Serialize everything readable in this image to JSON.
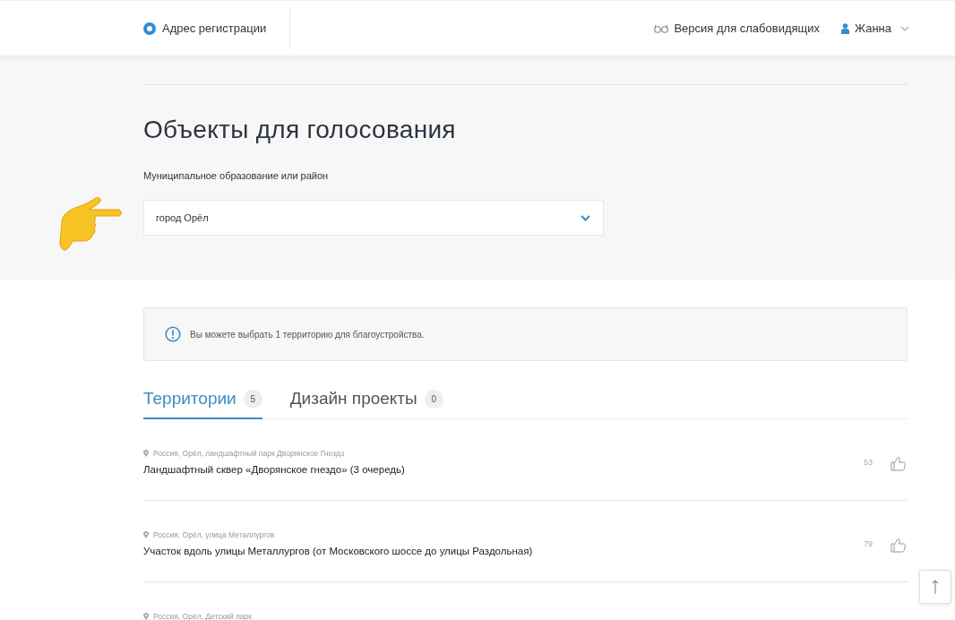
{
  "header": {
    "address_link": "Адрес регистрации",
    "accessibility_link": "Версия для слабовидящих",
    "user": "Жанна"
  },
  "title": "Объекты для голосования",
  "district": {
    "label": "Муниципальное образование или район",
    "value": "город Орёл"
  },
  "notice": "Вы можете выбрать 1 территорию для благоустройства.",
  "tabs": [
    {
      "label": "Территории",
      "count": "5",
      "selected": true
    },
    {
      "label": "Дизайн проекты",
      "count": "0",
      "selected": false
    }
  ],
  "items": [
    {
      "address": "Россия, Орёл, ландшафтный парк Дворянское Гнездо",
      "title": "Ландшафтный сквер «Дворянское гнездо» (3 очередь)",
      "likes": "53"
    },
    {
      "address": "Россия, Орёл, улица Металлургов",
      "title": "Участок вдоль улицы Металлургов (от Московского шоссе до улицы Раздольная)",
      "likes": "79"
    },
    {
      "address": "Россия, Орёл, Детский парк"
    }
  ]
}
